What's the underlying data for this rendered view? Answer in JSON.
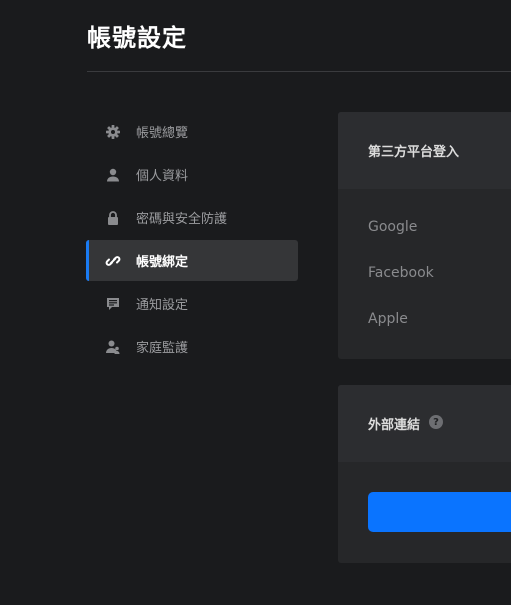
{
  "page": {
    "title": "帳號設定"
  },
  "sidebar": {
    "items": [
      {
        "label": "帳號總覽",
        "icon": "gear-icon",
        "active": false
      },
      {
        "label": "個人資料",
        "icon": "person-icon",
        "active": false
      },
      {
        "label": "密碼與安全防護",
        "icon": "lock-icon",
        "active": false
      },
      {
        "label": "帳號綁定",
        "icon": "link-icon",
        "active": true
      },
      {
        "label": "通知設定",
        "icon": "message-icon",
        "active": false
      },
      {
        "label": "家庭監護",
        "icon": "family-icon",
        "active": false
      }
    ]
  },
  "third_party": {
    "header": "第三方平台登入",
    "providers": [
      "Google",
      "Facebook",
      "Apple"
    ]
  },
  "external_links": {
    "header": "外部連結",
    "help_icon": "?"
  },
  "colors": {
    "accent": "#1a7bf2",
    "button": "#0a74ff",
    "background": "#1a1b1d"
  }
}
